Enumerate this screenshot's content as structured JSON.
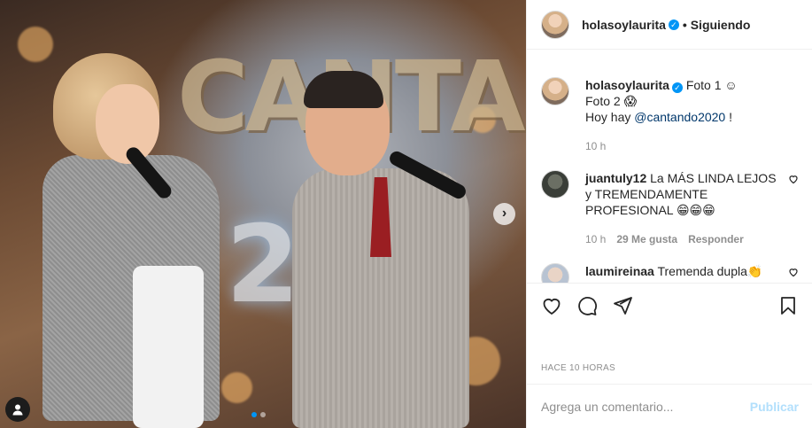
{
  "post": {
    "author": "holasoylaurita",
    "follow_state": "• Siguiendo",
    "verified": true
  },
  "photo": {
    "logo_text": "CANTAN",
    "year_text": "20",
    "carousel_next": "›",
    "total_slides": 2,
    "current_slide": 1
  },
  "caption": {
    "username": "holasoylaurita",
    "line1": "Foto 1 ☺",
    "line2": "Foto 2 😱",
    "line3_prefix": "Hoy hay ",
    "line3_mention": "@cantando2020",
    "line3_suffix": " !",
    "time": "10 h"
  },
  "comments": [
    {
      "username": "juantuly12",
      "text": "La MÁS LINDA LEJOS y TREMENDAMENTE PROFESIONAL 😁😁😁",
      "time": "10 h",
      "likes": "29 Me gusta",
      "reply": "Responder"
    },
    {
      "username": "laumireinaa",
      "text": "Tremenda dupla👏"
    }
  ],
  "footer": {
    "time_ago": "HACE 10 HORAS",
    "comment_placeholder": "Agrega un comentario...",
    "publish_label": "Publicar"
  },
  "icons": {
    "like": "heart-icon",
    "comment": "comment-icon",
    "share": "share-icon",
    "save": "bookmark-icon",
    "tagged": "user-tag-icon"
  }
}
